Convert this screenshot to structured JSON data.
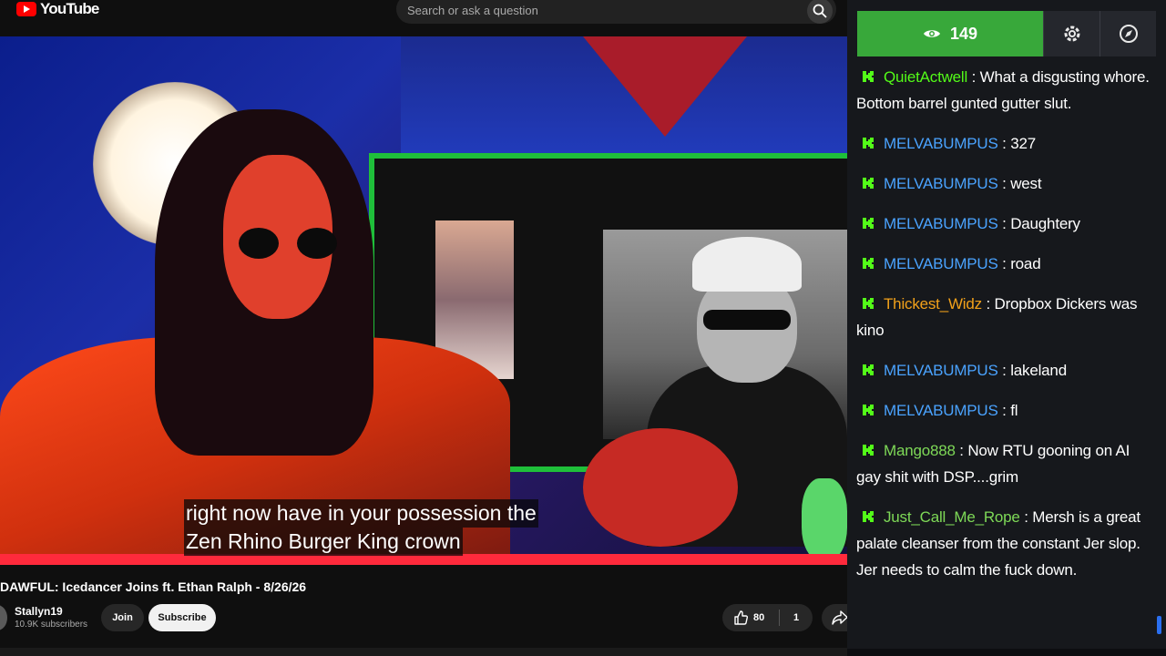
{
  "header": {
    "logo_text": "YouTube",
    "search_placeholder": "Search or ask a question"
  },
  "video": {
    "captions": [
      "right now have in your possession the",
      "Zen Rhino Burger King crown"
    ],
    "title": "DAWFUL: Icedancer Joins ft. Ethan Ralph - 8/26/26"
  },
  "channel": {
    "name": "Stallyn19",
    "subscribers": "10.9K subscribers",
    "join_label": "Join",
    "subscribe_label": "Subscribe",
    "likes": "80",
    "dislikes": "1"
  },
  "chat": {
    "viewer_count": "149",
    "accent": "#38a83a",
    "messages": [
      {
        "user": "QuietActwell",
        "color": "#53fc18",
        "text": "What a disgusting whore. Bottom barrel gunted gutter slut."
      },
      {
        "user": "MELVABUMPUS",
        "color": "#4aa3ff",
        "text": "327"
      },
      {
        "user": "MELVABUMPUS",
        "color": "#4aa3ff",
        "text": "west"
      },
      {
        "user": "MELVABUMPUS",
        "color": "#4aa3ff",
        "text": "Daughtery"
      },
      {
        "user": "MELVABUMPUS",
        "color": "#4aa3ff",
        "text": "road"
      },
      {
        "user": "Thickest_Widz",
        "color": "#f2a11a",
        "text": "Dropbox Dickers was kino"
      },
      {
        "user": "MELVABUMPUS",
        "color": "#4aa3ff",
        "text": "lakeland"
      },
      {
        "user": "MELVABUMPUS",
        "color": "#4aa3ff",
        "text": "fl"
      },
      {
        "user": "Mango888",
        "color": "#7ed957",
        "text": "Now RTU gooning on AI gay shit with DSP....grim"
      },
      {
        "user": "Just_Call_Me_Rope",
        "color": "#7ed957",
        "text": "Mersh is a great palate cleanser from the constant Jer slop. Jer needs to calm the fuck down."
      }
    ]
  }
}
